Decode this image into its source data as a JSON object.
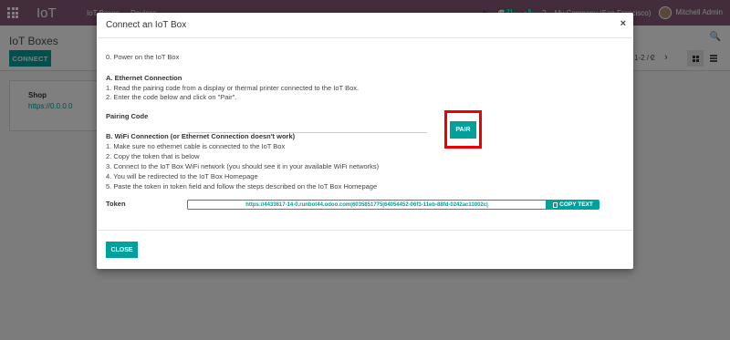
{
  "navbar": {
    "app_name": "IoT",
    "menu": [
      "IoT Boxes",
      "Devices"
    ],
    "messages_count": "21",
    "activity_count": "5",
    "company": "My Company (San Francisco)",
    "user_name": "Mitchell Admin",
    "color": "#875a7b"
  },
  "control_panel": {
    "title": "IoT Boxes",
    "connect_label": "CONNECT",
    "pager": "1-2 / 2"
  },
  "kanban": {
    "card": {
      "title": "Shop",
      "url": "https://0.0.0.0"
    }
  },
  "modal": {
    "title": "Connect an IoT Box",
    "close_glyph": "×",
    "step0": "0. Power on the IoT Box",
    "section_a": {
      "heading": "A. Ethernet Connection",
      "steps": [
        "1. Read the pairing code from a display or thermal printer connected to the IoT Box.",
        "2. Enter the code below and click on \"Pair\"."
      ],
      "pairing_label": "Pairing Code",
      "pairing_value": "",
      "pair_label": "PAIR"
    },
    "section_b": {
      "heading": "B. WiFi Connection (or Ethernet Connection doesn't work)",
      "steps": [
        "1. Make sure no ethernet cable is connected to the IoT Box",
        "2. Copy the token that is below",
        "3. Connect to the IoT Box WiFi network (you should see it in your available WiFi networks)",
        "4. You will be redirected to the IoT Box Homepage",
        "5. Paste the token in token field and follow the steps described on the IoT Box Homepage"
      ],
      "token_label": "Token",
      "token_value": "https://4433617-14-0.runbot44.odoo.com|6035851775|64054452-06f3-11eb-88fd-0242ac11002c|",
      "copy_label": "COPY TEXT"
    },
    "close_label": "CLOSE"
  },
  "colors": {
    "accent": "#00a09d",
    "highlight": "#ee0000"
  }
}
